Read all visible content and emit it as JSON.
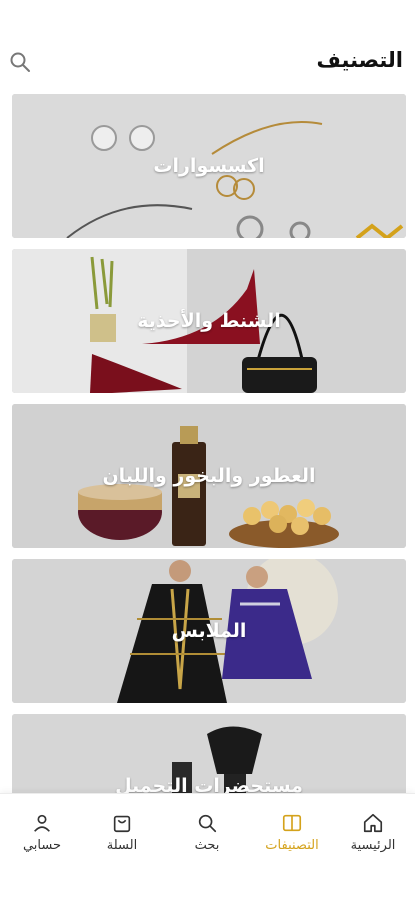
{
  "header": {
    "title": "التصنيف",
    "search_icon": "search-icon"
  },
  "categories": [
    {
      "label": "اكسسوارات",
      "bg": "#d8d8d8"
    },
    {
      "label": "الشنط والأحذية",
      "bg": "#d4d4d4"
    },
    {
      "label": "العطور والبخور واللبان",
      "bg": "#d2d2d2"
    },
    {
      "label": "الملابس",
      "bg": "#d5d5d5"
    },
    {
      "label": "مستحضرات التجميل",
      "bg": "#d6d6d6"
    }
  ],
  "nav": {
    "items": [
      {
        "label": "الرئيسية",
        "icon": "home-icon"
      },
      {
        "label": "التصنيفات",
        "icon": "categories-icon",
        "active": true
      },
      {
        "label": "بحث",
        "icon": "search-icon"
      },
      {
        "label": "السلة",
        "icon": "cart-icon"
      },
      {
        "label": "حسابي",
        "icon": "user-icon"
      }
    ]
  },
  "colors": {
    "accent": "#d4a21b",
    "card_overlay": "#cfcfcf"
  }
}
